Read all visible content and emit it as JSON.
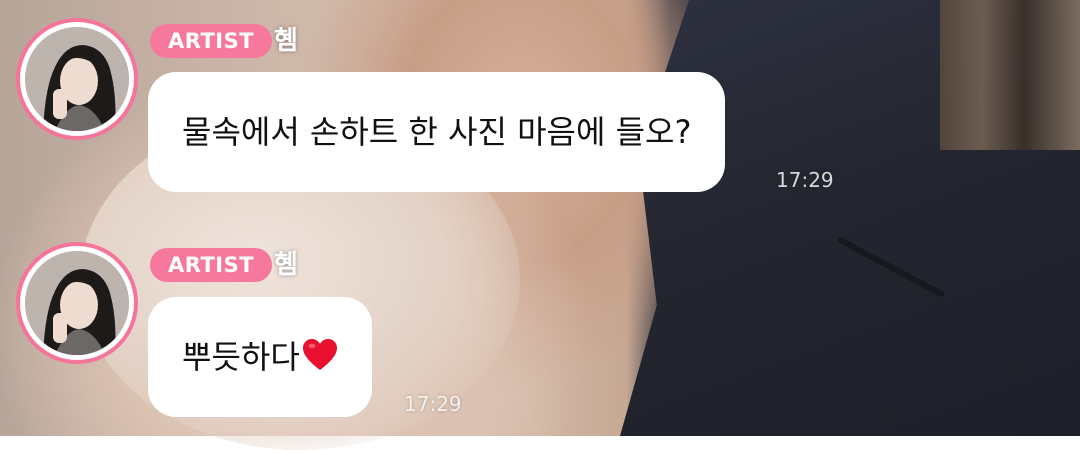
{
  "messages": [
    {
      "badge": "ARTIST",
      "nickname": "혬",
      "text": "물속에서 손하트 한 사진 마음에 들오?",
      "time": "17:29",
      "icon": null
    },
    {
      "badge": "ARTIST",
      "nickname": "혬",
      "text": "뿌듯하다",
      "time": "17:29",
      "icon": "heart-icon"
    }
  ],
  "colors": {
    "badge_bg": "#f7789d",
    "avatar_ring": "#f5759a",
    "bubble_bg": "#ffffff",
    "heart": "#e8102e"
  }
}
